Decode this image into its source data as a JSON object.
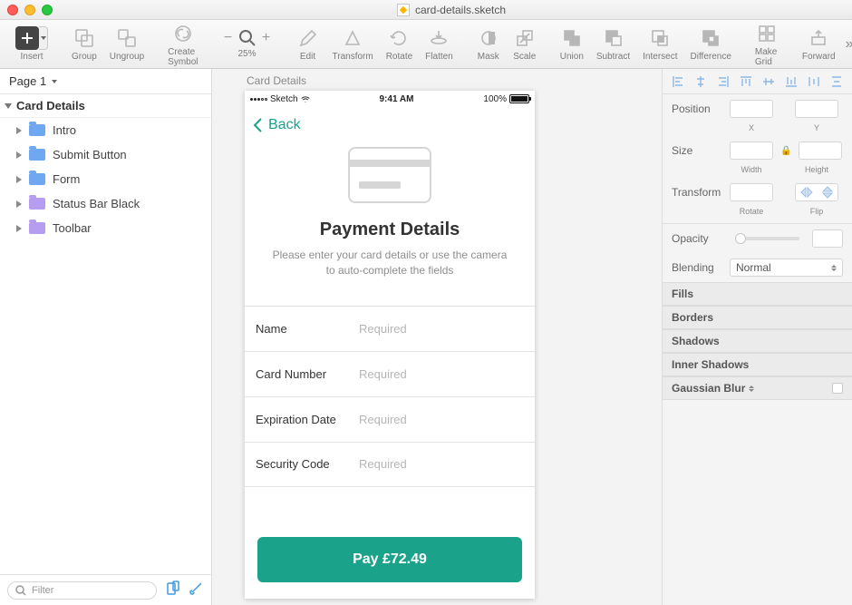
{
  "window": {
    "filename": "card-details.sketch"
  },
  "toolbar": {
    "insert": "Insert",
    "group": "Group",
    "ungroup": "Ungroup",
    "create_symbol": "Create Symbol",
    "zoom_pct": "25%",
    "edit": "Edit",
    "transform": "Transform",
    "rotate": "Rotate",
    "flatten": "Flatten",
    "mask": "Mask",
    "scale": "Scale",
    "union": "Union",
    "subtract": "Subtract",
    "intersect": "Intersect",
    "difference": "Difference",
    "make_grid": "Make Grid",
    "forward": "Forward"
  },
  "left": {
    "page": "Page 1",
    "root": "Card Details",
    "layers": [
      {
        "name": "Intro",
        "color": "blue"
      },
      {
        "name": "Submit Button",
        "color": "blue"
      },
      {
        "name": "Form",
        "color": "blue"
      },
      {
        "name": "Status Bar Black",
        "color": "purple"
      },
      {
        "name": "Toolbar",
        "color": "purple"
      }
    ],
    "filter_placeholder": "Filter"
  },
  "canvas": {
    "artboard_title": "Card Details",
    "statusbar": {
      "carrier": "Sketch",
      "time": "9:41 AM",
      "battery": "100%"
    },
    "back": "Back",
    "heading": "Payment Details",
    "sub": "Please enter your card details or use the camera to auto-complete the fields",
    "fields": [
      {
        "label": "Name",
        "placeholder": "Required"
      },
      {
        "label": "Card Number",
        "placeholder": "Required"
      },
      {
        "label": "Expiration Date",
        "placeholder": "Required"
      },
      {
        "label": "Security Code",
        "placeholder": "Required"
      }
    ],
    "pay": "Pay £72.49"
  },
  "inspector": {
    "position": "Position",
    "x": "X",
    "y": "Y",
    "size": "Size",
    "width": "Width",
    "height": "Height",
    "transform": "Transform",
    "rotate": "Rotate",
    "flip": "Flip",
    "opacity": "Opacity",
    "blending": "Blending",
    "blending_val": "Normal",
    "fills": "Fills",
    "borders": "Borders",
    "shadows": "Shadows",
    "inner_shadows": "Inner Shadows",
    "gaussian": "Gaussian Blur"
  }
}
